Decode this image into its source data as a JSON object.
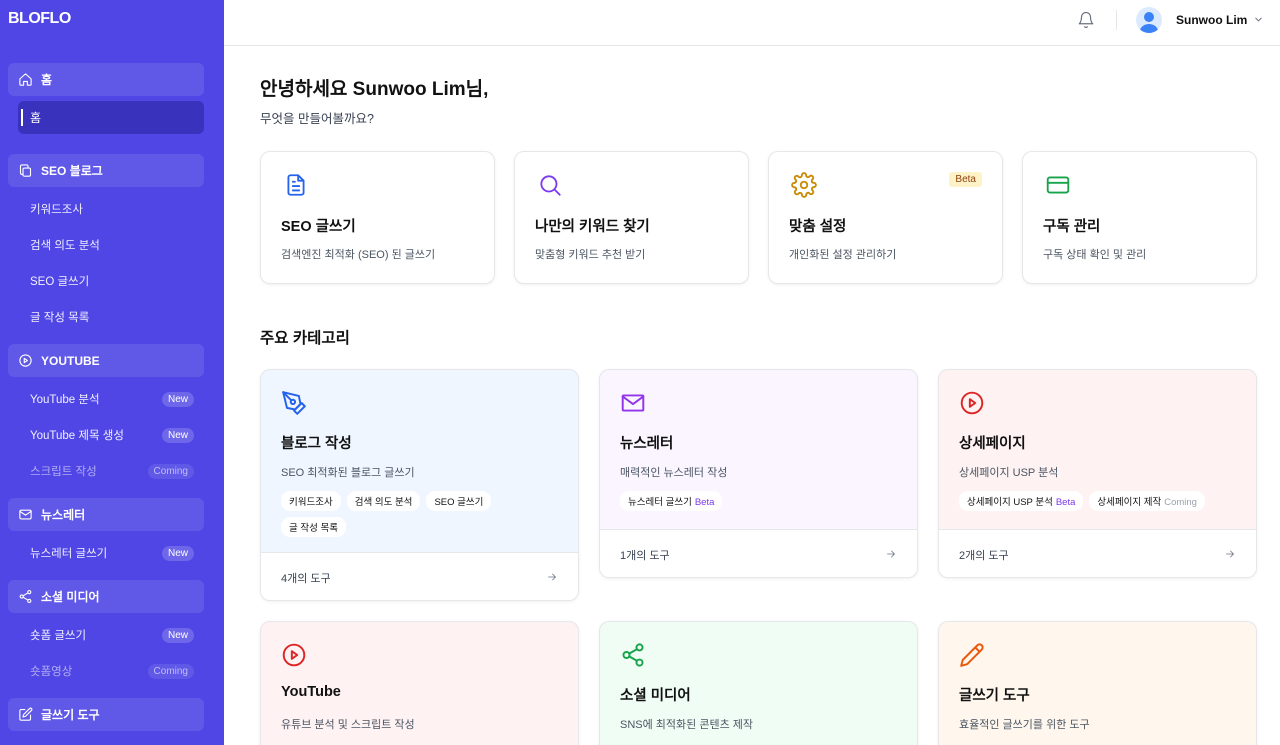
{
  "app": {
    "logo": "BLOFLO"
  },
  "user": {
    "name": "Sunwoo Lim"
  },
  "sidebar": {
    "home_section": "홈",
    "home_active": "홈",
    "seo_section": "SEO 블로그",
    "seo_items": [
      "키워드조사",
      "검색 의도 분석",
      "SEO 글쓰기",
      "글 작성 목록"
    ],
    "youtube_section": "YOUTUBE",
    "youtube_items": [
      {
        "label": "YouTube 분석",
        "badge": "New"
      },
      {
        "label": "YouTube 제목 생성",
        "badge": "New"
      },
      {
        "label": "스크립트 작성",
        "badge": "Coming"
      }
    ],
    "newsletter_section": "뉴스레터",
    "newsletter_items": [
      {
        "label": "뉴스레터 글쓰기",
        "badge": "New"
      }
    ],
    "social_section": "소셜 미디어",
    "social_items": [
      {
        "label": "숏폼 글쓰기",
        "badge": "New"
      },
      {
        "label": "숏폼영상",
        "badge": "Coming"
      }
    ],
    "writing_section": "글쓰기 도구"
  },
  "main": {
    "greeting": "안녕하세요 Sunwoo Lim님,",
    "subtitle": "무엇을 만들어볼까요?",
    "quick_cards": [
      {
        "title": "SEO 글쓰기",
        "desc": "검색엔진 최적화 (SEO) 된 글쓰기",
        "icon": "document-icon",
        "color": "#2563eb"
      },
      {
        "title": "나만의 키워드 찾기",
        "desc": "맞춤형 키워드 추천 받기",
        "icon": "search-icon",
        "color": "#7c3aed"
      },
      {
        "title": "맞춤 설정",
        "desc": "개인화된 설정 관리하기",
        "icon": "gear-icon",
        "color": "#ca8a04",
        "badge": "Beta"
      },
      {
        "title": "구독 관리",
        "desc": "구독 상태 확인 및 관리",
        "icon": "credit-card-icon",
        "color": "#16a34a"
      }
    ],
    "category_title": "주요 카테고리",
    "categories": [
      {
        "title": "블로그 작성",
        "desc": "SEO 최적화된 블로그 글쓰기",
        "icon": "pen-tool-icon",
        "color": "#2563eb",
        "bg": "#eff6ff",
        "tags": [
          {
            "label": "키워드조사"
          },
          {
            "label": "검색 의도 분석"
          },
          {
            "label": "SEO 글쓰기"
          },
          {
            "label": "글 작성 목록"
          }
        ],
        "count": "4개의 도구"
      },
      {
        "title": "뉴스레터",
        "desc": "매력적인 뉴스레터 작성",
        "icon": "mail-icon",
        "color": "#9333ea",
        "bg": "#faf5ff",
        "tags": [
          {
            "label": "뉴스레터 글쓰기",
            "status": "Beta"
          }
        ],
        "count": "1개의 도구"
      },
      {
        "title": "상세페이지",
        "desc": "상세페이지 USP 분석",
        "icon": "play-circle-icon",
        "color": "#dc2626",
        "bg": "#fef2f2",
        "tags": [
          {
            "label": "상세페이지 USP 분석",
            "status": "Beta"
          },
          {
            "label": "상세페이지 제작",
            "status": "Coming"
          }
        ],
        "count": "2개의 도구"
      },
      {
        "title": "YouTube",
        "desc": "유튜브 분석 및 스크립트 작성",
        "icon": "play-circle-icon",
        "color": "#dc2626",
        "bg": "#fef2f2"
      },
      {
        "title": "소셜 미디어",
        "desc": "SNS에 최적화된 콘텐츠 제작",
        "icon": "share-icon",
        "color": "#16a34a",
        "bg": "#f0fdf4"
      },
      {
        "title": "글쓰기 도구",
        "desc": "효율적인 글쓰기를 위한 도구",
        "icon": "pencil-icon",
        "color": "#ea580c",
        "bg": "#fff7ed"
      }
    ]
  }
}
